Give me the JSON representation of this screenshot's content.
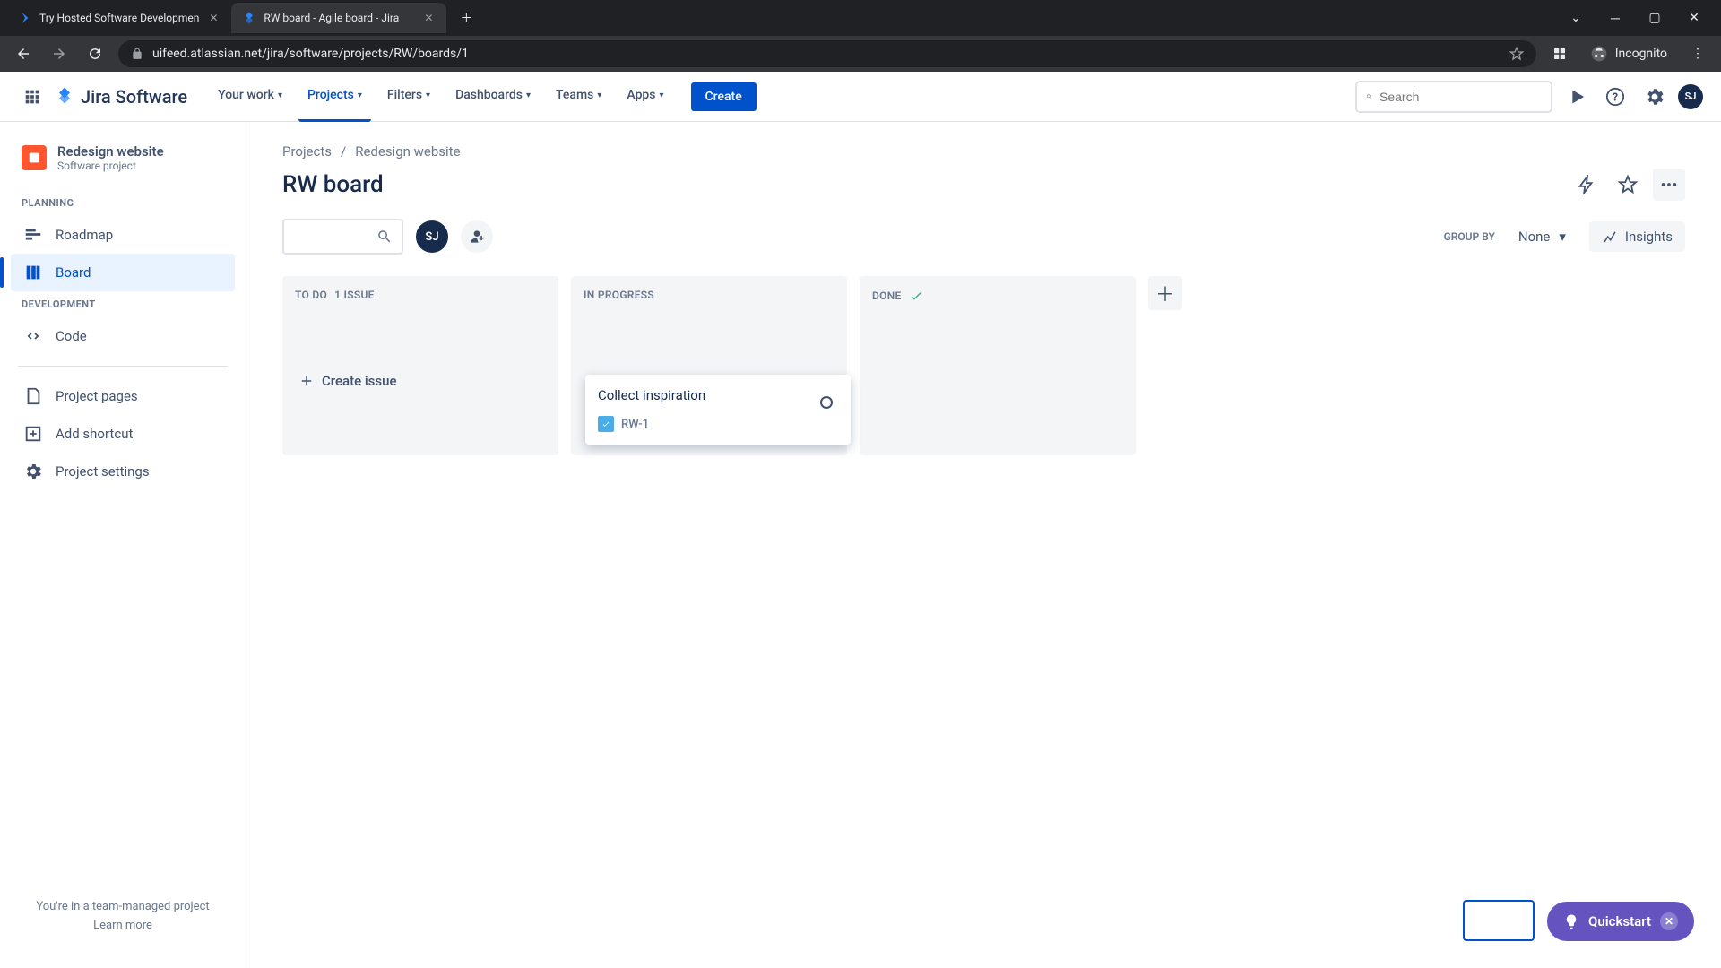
{
  "browser": {
    "tabs": [
      {
        "title": "Try Hosted Software Developmen",
        "active": false
      },
      {
        "title": "RW board - Agile board - Jira",
        "active": true
      }
    ],
    "url": "uifeed.atlassian.net/jira/software/projects/RW/boards/1",
    "incognito_label": "Incognito"
  },
  "topnav": {
    "logo": "Jira Software",
    "items": [
      "Your work",
      "Projects",
      "Filters",
      "Dashboards",
      "Teams",
      "Apps"
    ],
    "active_index": 1,
    "create_label": "Create",
    "search_placeholder": "Search",
    "avatar_initials": "SJ"
  },
  "sidebar": {
    "project_name": "Redesign website",
    "project_type": "Software project",
    "planning_label": "PLANNING",
    "planning_items": [
      "Roadmap",
      "Board"
    ],
    "planning_active_index": 1,
    "development_label": "DEVELOPMENT",
    "development_items": [
      "Code"
    ],
    "bottom_items": [
      "Project pages",
      "Add shortcut",
      "Project settings"
    ],
    "footer_text": "You're in a team-managed project",
    "footer_link": "Learn more"
  },
  "breadcrumb": [
    "Projects",
    "Redesign website"
  ],
  "board_title": "RW board",
  "filters": {
    "member_initials": "SJ",
    "group_by_label": "GROUP BY",
    "group_by_value": "None",
    "insights_label": "Insights"
  },
  "columns": [
    {
      "title": "TO DO",
      "count_label": "1 ISSUE",
      "has_create": true
    },
    {
      "title": "IN PROGRESS"
    },
    {
      "title": "DONE",
      "done": true
    }
  ],
  "create_issue_label": "Create issue",
  "card": {
    "title": "Collect inspiration",
    "key": "RW-1"
  },
  "quickstart_label": "Quickstart"
}
